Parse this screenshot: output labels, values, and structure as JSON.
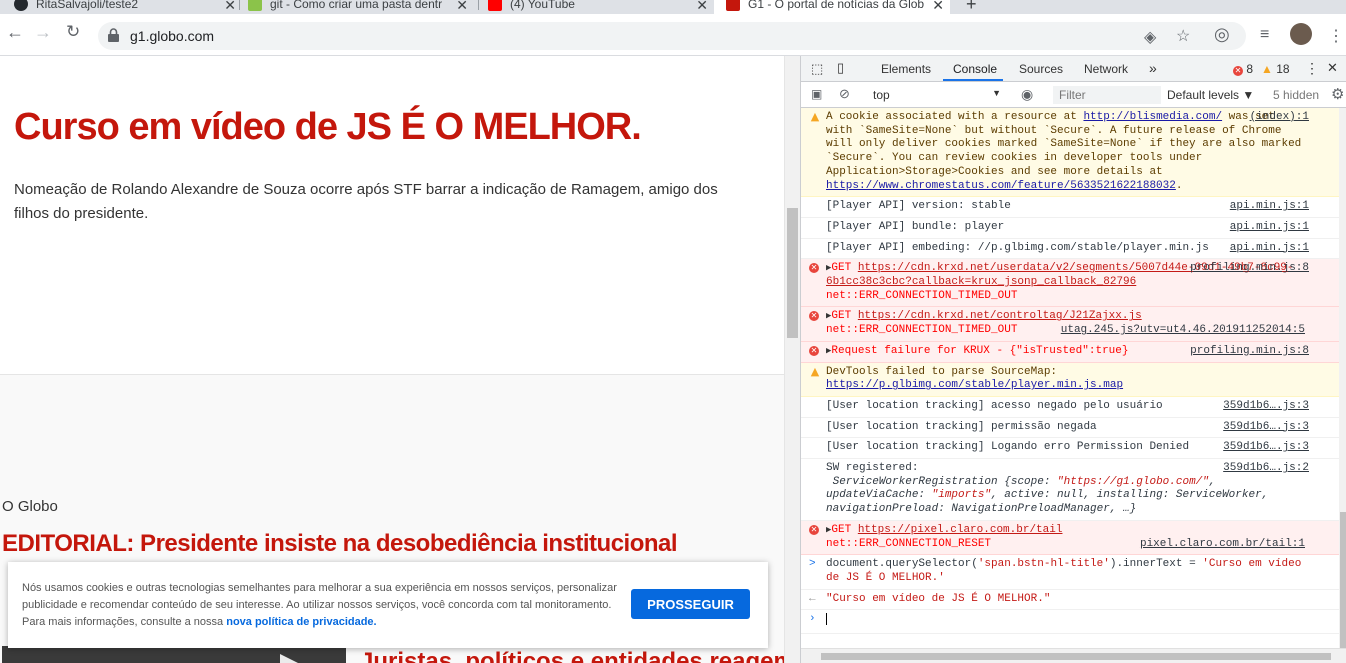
{
  "browser": {
    "tabs": [
      {
        "title": "RitaSalvajoli/teste2",
        "close": "✕"
      },
      {
        "title": "git - Como criar uma pasta dentr",
        "close": "✕"
      },
      {
        "title": "(4) YouTube",
        "close": "✕"
      },
      {
        "title": "G1 - O portal de notícias da Glob",
        "close": "✕"
      }
    ],
    "new_tab": "+",
    "url": "g1.globo.com"
  },
  "page": {
    "hero_title": "Curso em vídeo de JS É O MELHOR.",
    "hero_subtitle": "Nomeação de Rolando Alexandre de Souza ocorre após STF barrar a indicação de Ramagem, amigo dos filhos do presidente.",
    "source": "O Globo",
    "editorial": "EDITORIAL: Presidente insiste na desobediência institucional",
    "headline2": "Juristas, políticos e entidades reagem",
    "cookie": {
      "text": "Nós usamos cookies e outras tecnologias semelhantes para melhorar a sua experiência em nossos serviços, personalizar publicidade e recomendar conteúdo de seu interesse. Ao utilizar nossos serviços, você concorda com tal monitoramento. Para mais informações, consulte a nossa ",
      "link": "nova política de privacidade.",
      "button": "PROSSEGUIR"
    }
  },
  "devtools": {
    "tabs": [
      "Elements",
      "Console",
      "Sources",
      "Network",
      "»"
    ],
    "errors": "8",
    "warnings": "18",
    "context": "top",
    "filter_placeholder": "Filter",
    "levels": "Default levels ▼",
    "hidden": "5 hidden",
    "messages": [
      {
        "kind": "warn",
        "html": "A cookie associated with a resource at <span class='lnk'>http://blismedia.com/</span> was set with `SameSite=None` but without `Secure`. A future release of Chrome will only deliver cookies marked `SameSite=None` if they are also marked `Secure`. You can review cookies in developer tools under Application&gt;Storage&gt;Cookies and see more details at <span class='lnk'>https://www.chromestatus.com/feature/5633521622188032</span>.",
        "src": "(index):1"
      },
      {
        "kind": "log",
        "text": "[Player API] version: stable",
        "src": "api.min.js:1"
      },
      {
        "kind": "log",
        "text": "[Player API] bundle: player",
        "src": "api.min.js:1"
      },
      {
        "kind": "log",
        "text": "[Player API] embeding: //p.glbimg.com/stable/player.min.js",
        "src": "api.min.js:1"
      },
      {
        "kind": "err",
        "html": "<span class='arrow'>▶</span>GET <span class='lnk'>https://cdn.krxd.net/userdata/v2/segments/5007d44e-09d1-49b7-8c99-6b1cc38c3cbc?callback=krux_jsonp_callback_82796</span><br>net::ERR_CONNECTION_TIMED_OUT",
        "src": "profiling.min.js:8"
      },
      {
        "kind": "err",
        "html": "<span class='arrow'>▶</span>GET <span class='lnk'>https://cdn.krxd.net/controltag/J21Zajxx.js</span> net::ERR_CONNECTION_TIMED_OUT",
        "src": "utag.245.js?utv=ut4.46.201911252014:5"
      },
      {
        "kind": "err",
        "html": "<span class='arrow'>▶</span>Request failure for KRUX - {\"isTrusted\":true}",
        "src": "profiling.min.js:8"
      },
      {
        "kind": "warn",
        "html": "DevTools failed to parse SourceMap: <span class='lnk'>https://p.glbimg.com/stable/player.min.js.map</span>",
        "src": ""
      },
      {
        "kind": "log",
        "text": "[User location tracking] acesso negado pelo usuário",
        "src": "359d1b6….js:3"
      },
      {
        "kind": "log",
        "text": "[User location tracking] permissão negada",
        "src": "359d1b6….js:3"
      },
      {
        "kind": "log",
        "text": "[User location tracking] Logando erro Permission Denied",
        "src": "359d1b6….js:3"
      },
      {
        "kind": "log",
        "html": "SW registered:<br>&nbsp;<span class='it'>ServiceWorkerRegistration {scope: <span class='str'>\"https://g1.globo.com/\"</span>, updateViaCache: <span class='str'>\"imports\"</span>, active: null, installing: ServiceWorker, navigationPreload: NavigationPreloadManager, …}</span>",
        "src": "359d1b6….js:2"
      },
      {
        "kind": "err",
        "html": "<span class='arrow'>▶</span>GET <span class='lnk'>https://pixel.claro.com.br/tail</span><br>net::ERR_CONNECTION_RESET",
        "src": "pixel.claro.com.br/tail:1"
      },
      {
        "kind": "input",
        "html": "document.querySelector(<span class='str'>'span.bstn-hl-title'</span>).innerText = <span class='str'>'Curso em vídeo de JS É O MELHOR.'</span>",
        "src": ""
      },
      {
        "kind": "result",
        "html": "<span class='str'>\"Curso em vídeo de JS É O MELHOR.\"</span>",
        "src": ""
      },
      {
        "kind": "prompt",
        "html": "",
        "src": ""
      }
    ]
  }
}
